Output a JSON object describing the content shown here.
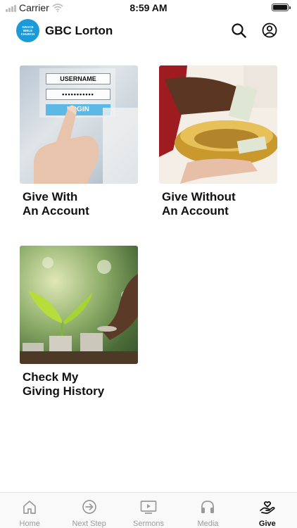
{
  "status_bar": {
    "carrier": "Carrier",
    "time": "8:59 AM"
  },
  "header": {
    "logo_text": "GRACE BIBLE CHURCH",
    "title": "GBC Lorton",
    "icons": [
      "search-icon",
      "profile-icon"
    ]
  },
  "tiles": [
    {
      "line1": "Give With",
      "line2": "An Account",
      "image": "login-form-photo",
      "login": {
        "username_label": "USERNAME",
        "password_mask": "•••••••••••",
        "button_label": "LOGIN"
      }
    },
    {
      "line1": "Give Without",
      "line2": "An Account",
      "image": "offering-plate-photo"
    },
    {
      "line1": "Check My",
      "line2": "Giving History",
      "image": "plant-coins-photo"
    }
  ],
  "bottom_nav": {
    "items": [
      {
        "label": "Home",
        "icon": "home-icon",
        "active": false
      },
      {
        "label": "Next Step",
        "icon": "arrow-circle-icon",
        "active": false
      },
      {
        "label": "Sermons",
        "icon": "video-icon",
        "active": false
      },
      {
        "label": "Media",
        "icon": "headphones-icon",
        "active": false
      },
      {
        "label": "Give",
        "icon": "heart-hand-icon",
        "active": true
      }
    ]
  },
  "colors": {
    "accent": "#1a9ad9",
    "nav_inactive": "#9a9a9a",
    "nav_active": "#111111"
  }
}
